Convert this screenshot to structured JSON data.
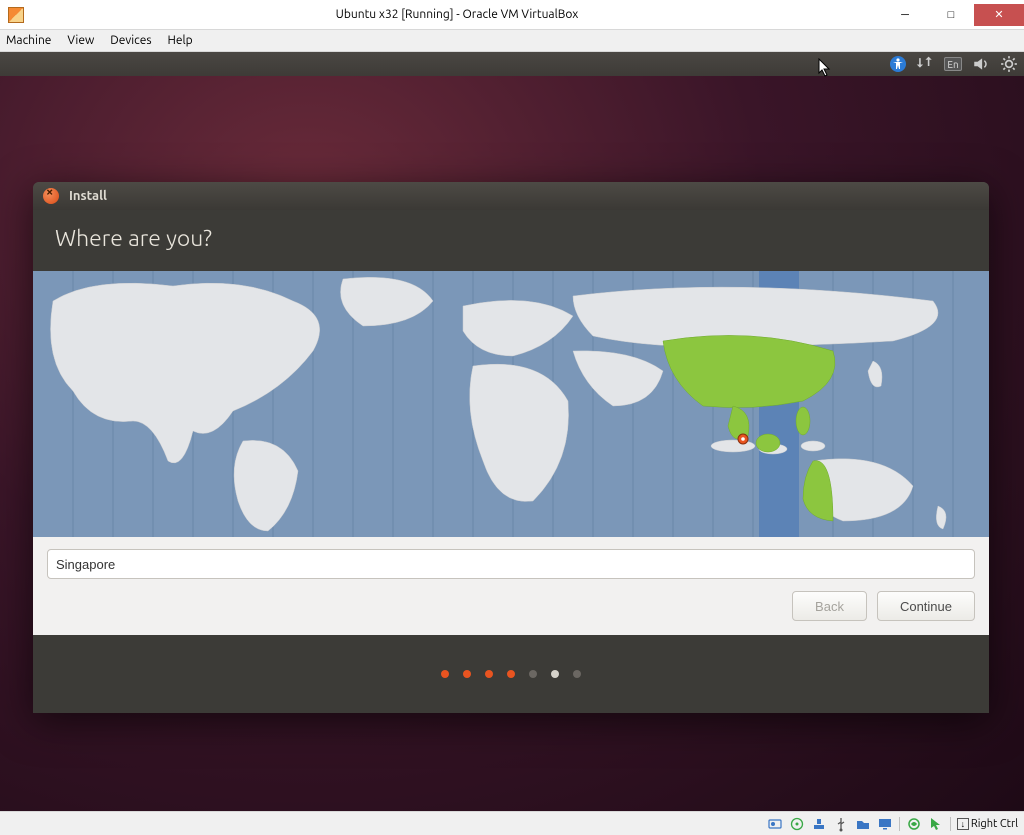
{
  "host_window": {
    "title": "Ubuntu x32 [Running] - Oracle VM VirtualBox",
    "menus": [
      "Machine",
      "View",
      "Devices",
      "Help"
    ]
  },
  "ubuntu_panel": {
    "lang": "En"
  },
  "installer": {
    "title": "Install",
    "heading": "Where are you?",
    "timezone_value": "Singapore",
    "back_label": "Back",
    "continue_label": "Continue",
    "progress": {
      "total": 7,
      "completed": 4,
      "current_index": 5
    }
  },
  "statusbar": {
    "host_key": "Right Ctrl"
  },
  "colors": {
    "accent": "#e95420",
    "map_ocean": "#7b97b8",
    "map_land": "#e3e5e8",
    "map_highlight": "#8cc63f",
    "tz_band": "#5c83b6"
  }
}
